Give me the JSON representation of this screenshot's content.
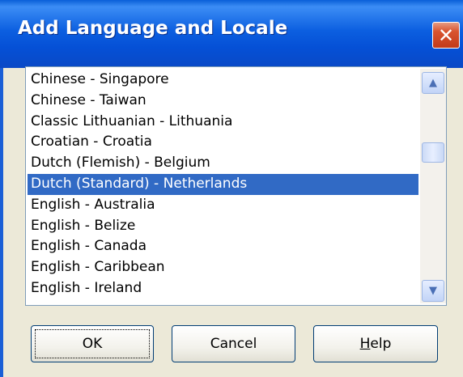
{
  "window": {
    "title": "Add Language and Locale",
    "close_glyph": "✕"
  },
  "list": {
    "items": [
      {
        "label": "Chinese - Singapore",
        "selected": false
      },
      {
        "label": "Chinese - Taiwan",
        "selected": false
      },
      {
        "label": "Classic Lithuanian - Lithuania",
        "selected": false
      },
      {
        "label": "Croatian - Croatia",
        "selected": false
      },
      {
        "label": "Dutch (Flemish) - Belgium",
        "selected": false
      },
      {
        "label": "Dutch (Standard) - Netherlands",
        "selected": true
      },
      {
        "label": "English - Australia",
        "selected": false
      },
      {
        "label": "English - Belize",
        "selected": false
      },
      {
        "label": "English - Canada",
        "selected": false
      },
      {
        "label": "English - Caribbean",
        "selected": false
      },
      {
        "label": "English - Ireland",
        "selected": false
      }
    ],
    "selection_color": "#316ac5"
  },
  "scrollbar": {
    "up_icon": "chevron-up-icon",
    "down_icon": "chevron-down-icon",
    "up_glyph": "▲",
    "down_glyph": "▼"
  },
  "buttons": {
    "ok_label": "OK",
    "cancel_label": "Cancel",
    "help_label_first": "H",
    "help_label_rest": "elp"
  },
  "colors": {
    "titlebar": "#0a5fd8",
    "close_button": "#d9542f",
    "dialog_background": "#ece9d8"
  }
}
